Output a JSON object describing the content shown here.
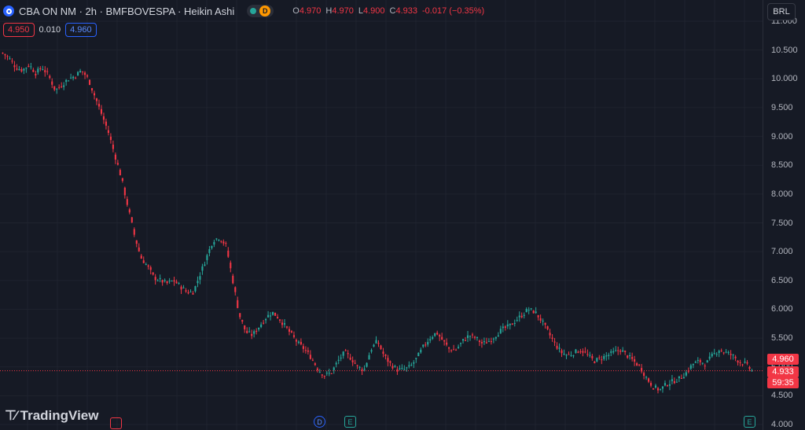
{
  "header": {
    "title": "CBA ON NM · 2h · BMFBOVESPA · Heikin Ashi",
    "badge": "D",
    "ohlc": [
      {
        "k": "O",
        "v": "4.970"
      },
      {
        "k": "H",
        "v": "4.970"
      },
      {
        "k": "L",
        "v": "4.900"
      },
      {
        "k": "C",
        "v": "4.933"
      },
      {
        "k": "",
        "v": "-0.017 (−0.35%)"
      }
    ]
  },
  "order": {
    "sell": "4.950",
    "spread": "0.010",
    "buy": "4.960"
  },
  "currency": "BRL",
  "price_labels": {
    "high": "4.960",
    "last": "4.933",
    "countdown": "59:35"
  },
  "events": {
    "dividend": "D",
    "earnings1": "E",
    "earnings2": "E"
  },
  "brand": "TradingView",
  "colors": {
    "bg": "#161a25",
    "up": "#26a69a",
    "down": "#f23645",
    "grid": "#222631"
  },
  "chart_data": {
    "type": "candlestick",
    "title": "CBA ON NM · 2h · BMFBOVESPA · Heikin Ashi",
    "ylim": [
      4.0,
      11.0
    ],
    "y_ticks": [
      "11.000",
      "10.500",
      "10.000",
      "9.500",
      "9.000",
      "8.500",
      "8.000",
      "7.500",
      "7.000",
      "6.500",
      "6.000",
      "5.500",
      "5.000",
      "4.500",
      "4.000"
    ],
    "close_series": [
      10.45,
      10.35,
      10.2,
      10.15,
      10.25,
      10.1,
      10.2,
      10.05,
      9.8,
      9.9,
      10.0,
      10.05,
      10.15,
      10.0,
      9.7,
      9.4,
      9.1,
      8.7,
      8.3,
      7.8,
      7.3,
      6.9,
      6.75,
      6.55,
      6.5,
      6.45,
      6.5,
      6.4,
      6.3,
      6.3,
      6.6,
      6.9,
      7.2,
      7.25,
      7.1,
      6.5,
      5.9,
      5.6,
      5.55,
      5.7,
      5.85,
      5.95,
      5.85,
      5.7,
      5.55,
      5.4,
      5.3,
      5.15,
      4.95,
      4.85,
      4.9,
      5.1,
      5.25,
      5.15,
      5.0,
      4.95,
      5.3,
      5.45,
      5.2,
      5.05,
      4.95,
      4.95,
      5.0,
      5.15,
      5.35,
      5.5,
      5.6,
      5.45,
      5.3,
      5.3,
      5.45,
      5.55,
      5.5,
      5.4,
      5.45,
      5.55,
      5.65,
      5.7,
      5.8,
      5.9,
      6.0,
      5.95,
      5.8,
      5.6,
      5.4,
      5.25,
      5.2,
      5.25,
      5.3,
      5.2,
      5.1,
      5.15,
      5.2,
      5.25,
      5.3,
      5.2,
      5.1,
      5.0,
      4.8,
      4.65,
      4.6,
      4.7,
      4.75,
      4.8,
      4.9,
      5.05,
      5.1,
      5.05,
      5.2,
      5.3,
      5.25,
      5.2,
      5.1,
      5.05,
      4.93
    ]
  }
}
